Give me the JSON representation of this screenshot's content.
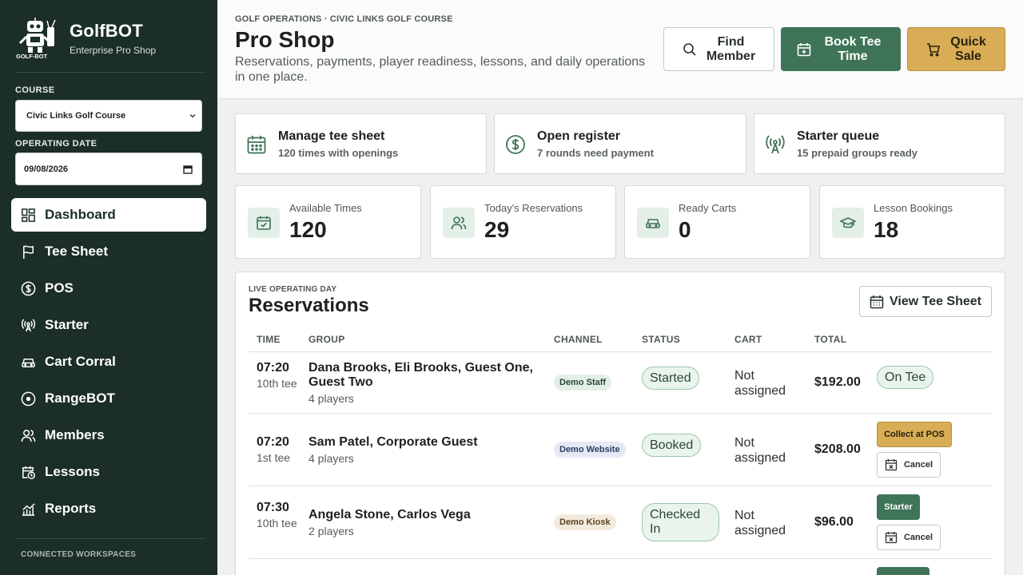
{
  "brand": {
    "name": "GolfBOT",
    "subtitle": "Enterprise Pro Shop",
    "logo_text": "GOLF-BOT"
  },
  "sidebar": {
    "course_label": "COURSE",
    "course_value": "Civic Links Golf Course",
    "date_label": "OPERATING DATE",
    "date_value": "09/08/2026",
    "nav": [
      {
        "label": "Dashboard",
        "icon": "dashboard-icon",
        "active": true
      },
      {
        "label": "Tee Sheet",
        "icon": "flag-icon"
      },
      {
        "label": "POS",
        "icon": "dollar-icon"
      },
      {
        "label": "Starter",
        "icon": "broadcast-icon"
      },
      {
        "label": "Cart Corral",
        "icon": "cart-icon"
      },
      {
        "label": "RangeBOT",
        "icon": "target-icon"
      },
      {
        "label": "Members",
        "icon": "users-icon"
      },
      {
        "label": "Lessons",
        "icon": "calendar-clock-icon"
      },
      {
        "label": "Reports",
        "icon": "chart-icon"
      }
    ],
    "workspaces_label": "CONNECTED WORKSPACES"
  },
  "header": {
    "breadcrumb": "GOLF OPERATIONS · CIVIC LINKS GOLF COURSE",
    "title": "Pro Shop",
    "description": "Reservations, payments, player readiness, lessons, and daily operations in one place.",
    "find_member": "Find Member",
    "book_tee_time": "Book Tee Time",
    "quick_sale": "Quick Sale"
  },
  "quick_actions": [
    {
      "title": "Manage tee sheet",
      "subtitle": "120 times with openings",
      "icon": "calendar-icon"
    },
    {
      "title": "Open register",
      "subtitle": "7 rounds need payment",
      "icon": "dollar-icon"
    },
    {
      "title": "Starter queue",
      "subtitle": "15 prepaid groups ready",
      "icon": "broadcast-icon"
    }
  ],
  "stats": [
    {
      "label": "Available Times",
      "value": "120",
      "icon": "calendar-check-icon"
    },
    {
      "label": "Today's Reservations",
      "value": "29",
      "icon": "users-icon"
    },
    {
      "label": "Ready Carts",
      "value": "0",
      "icon": "cart-icon"
    },
    {
      "label": "Lesson Bookings",
      "value": "18",
      "icon": "graduation-cap-icon"
    }
  ],
  "reservations": {
    "eyebrow": "LIVE OPERATING DAY",
    "title": "Reservations",
    "view_button": "View Tee Sheet",
    "columns": [
      "TIME",
      "GROUP",
      "CHANNEL",
      "STATUS",
      "CART",
      "TOTAL"
    ],
    "rows": [
      {
        "time": "07:20",
        "tee": "10th tee",
        "group": "Dana Brooks, Eli Brooks, Guest One, Guest Two",
        "players": "4 players",
        "channel": "Demo Staff",
        "status": "Started",
        "cart": "Not assigned",
        "total": "$192.00",
        "action": "On Tee"
      },
      {
        "time": "07:20",
        "tee": "1st tee",
        "group": "Sam Patel, Corporate Guest",
        "players": "4 players",
        "channel": "Demo Website",
        "status": "Booked",
        "cart": "Not assigned",
        "total": "$208.00",
        "action": "Collect at POS",
        "secondary": "Cancel"
      },
      {
        "time": "07:30",
        "tee": "10th tee",
        "group": "Angela Stone, Carlos Vega",
        "players": "2 players",
        "channel": "Demo Kiosk",
        "status": "Checked In",
        "cart": "Not assigned",
        "total": "$96.00",
        "action": "Starter",
        "secondary": "Cancel"
      }
    ]
  },
  "colors": {
    "sidebar": "#1b2e27",
    "primary": "#3f7458",
    "accent": "#d8ad55"
  }
}
